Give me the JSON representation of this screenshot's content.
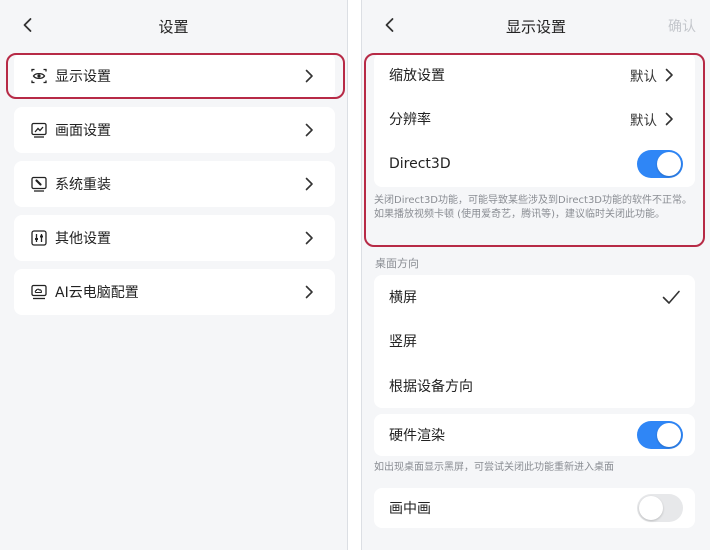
{
  "left": {
    "title": "设置",
    "menu": [
      {
        "label": "显示设置",
        "icon": "eye-icon"
      },
      {
        "label": "画面设置",
        "icon": "monitor-chart-icon"
      },
      {
        "label": "系统重装",
        "icon": "reinstall-icon"
      },
      {
        "label": "其他设置",
        "icon": "sliders-icon"
      },
      {
        "label": "AI云电脑配置",
        "icon": "cloud-pc-icon"
      }
    ]
  },
  "right": {
    "title": "显示设置",
    "confirm": "确认",
    "scale": {
      "label": "缩放设置",
      "value": "默认"
    },
    "resolution": {
      "label": "分辨率",
      "value": "默认"
    },
    "direct3d": {
      "label": "Direct3D",
      "enabled": true
    },
    "direct3d_note": "关闭Direct3D功能，可能导致某些涉及到Direct3D功能的软件不正常。如果播放视频卡顿 (使用爱奇艺，腾讯等)，建议临时关闭此功能。",
    "orientation_label": "桌面方向",
    "orientation": [
      {
        "label": "横屏",
        "selected": true
      },
      {
        "label": "竖屏",
        "selected": false
      },
      {
        "label": "根据设备方向",
        "selected": false
      }
    ],
    "hw_render": {
      "label": "硬件渲染",
      "enabled": true
    },
    "hw_note": "如出现桌面显示黑屏，可尝试关闭此功能重新进入桌面",
    "pip": {
      "label": "画中画",
      "enabled": false
    }
  },
  "colors": {
    "accent": "#2f86f6",
    "highlight": "#b72a46",
    "toggle_off": "#e7e8ea"
  }
}
